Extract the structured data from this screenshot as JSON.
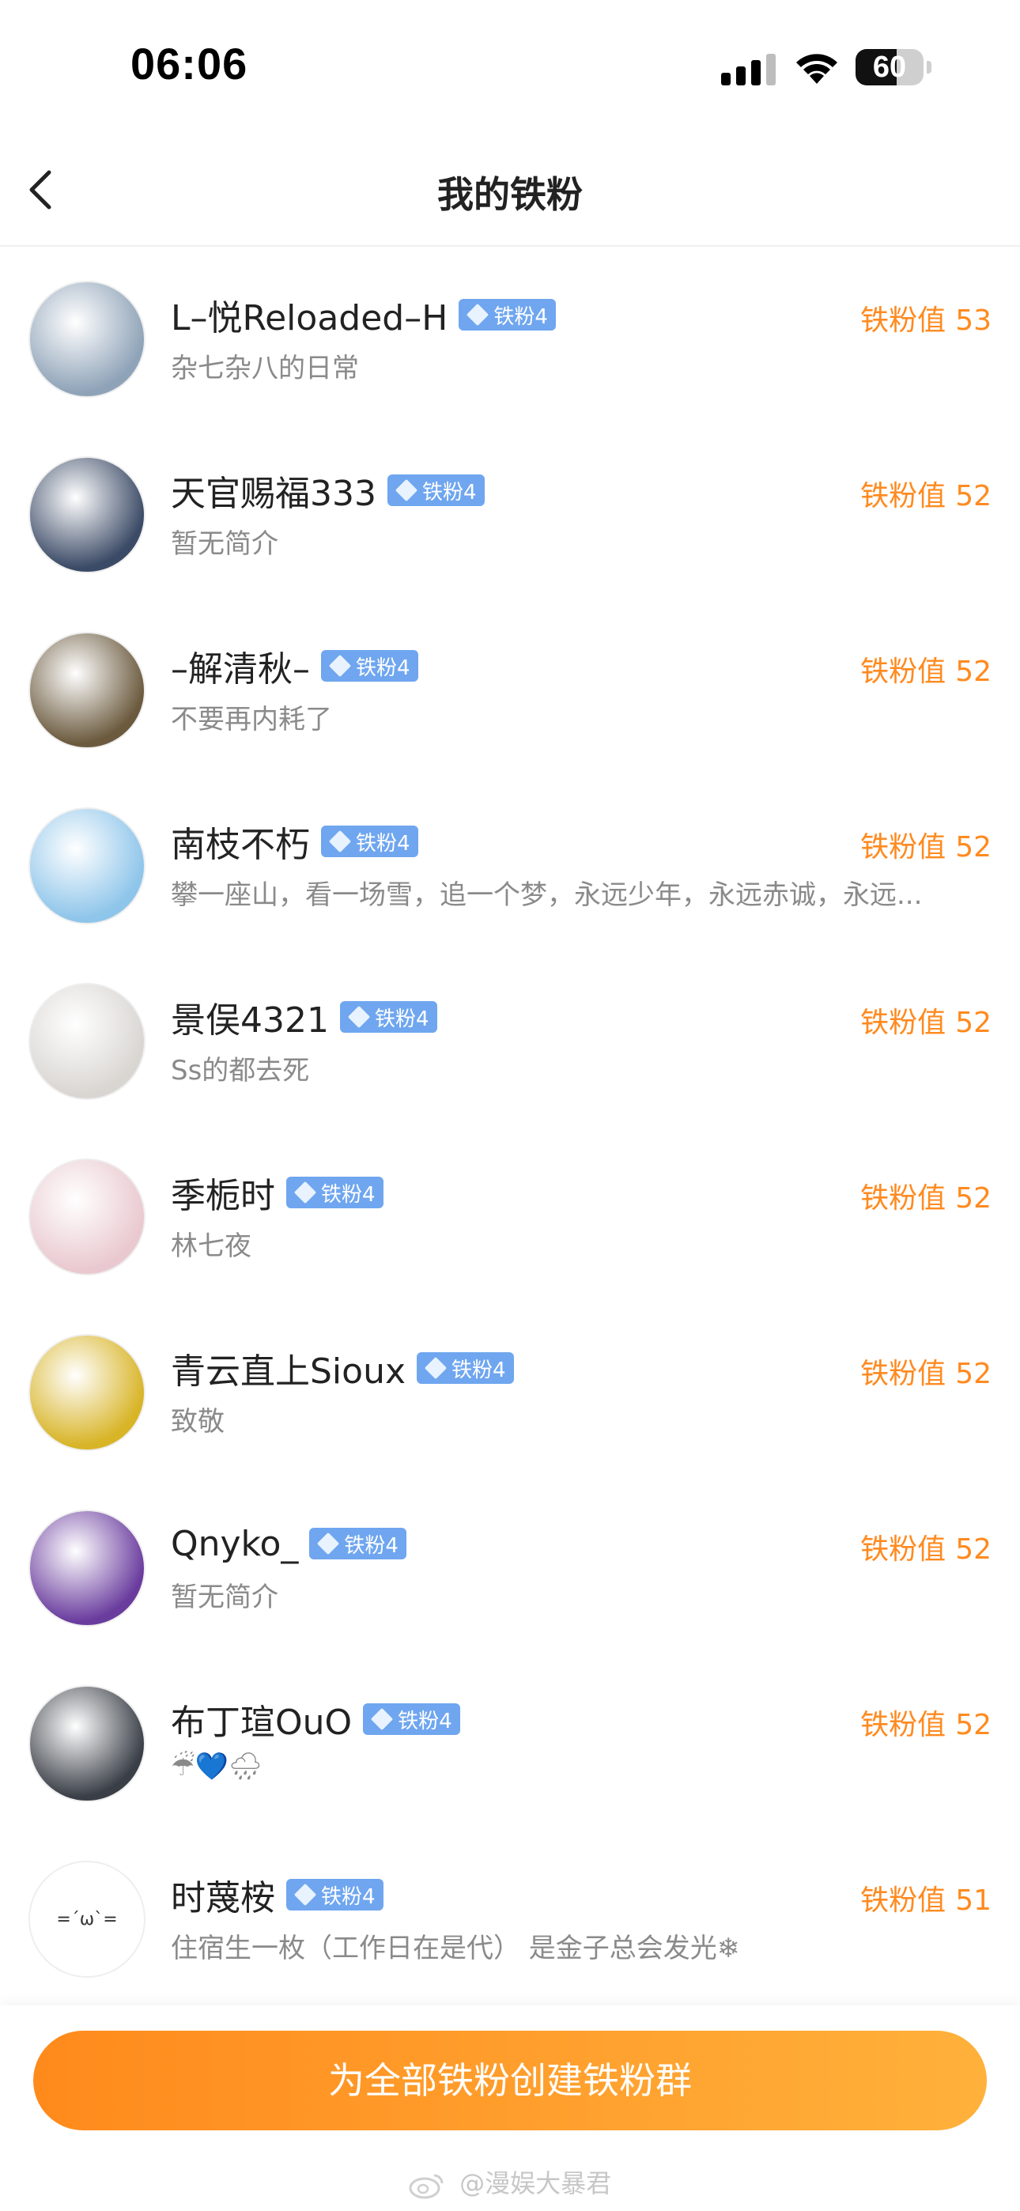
{
  "status_bar": {
    "time": "06:06",
    "battery_level": "60",
    "battery_fill_fraction": 0.6
  },
  "nav": {
    "title": "我的铁粉"
  },
  "score_label": "铁粉值",
  "fans": [
    {
      "name": "L–悦Reloaded–H",
      "badge": "铁粉4",
      "bio": "杂七杂八的日常",
      "score": "53",
      "avatar_color": "#8fa3b8"
    },
    {
      "name": "天官赐福333",
      "badge": "铁粉4",
      "bio": "暂无简介",
      "score": "52",
      "avatar_color": "#3b4a66"
    },
    {
      "name": "–解清秋–",
      "badge": "铁粉4",
      "bio": "不要再内耗了",
      "score": "52",
      "avatar_color": "#6b5a3e"
    },
    {
      "name": "南枝不朽",
      "badge": "铁粉4",
      "bio": "攀一座山，看一场雪，追一个梦，永远少年，永远赤诚，永远...",
      "score": "52",
      "avatar_color": "#8ec5ea"
    },
    {
      "name": "景俣4321",
      "badge": "铁粉4",
      "bio": "Ss的都去死",
      "score": "52",
      "avatar_color": "#d9d6d2"
    },
    {
      "name": "季栀时",
      "badge": "铁粉4",
      "bio": "林七夜",
      "score": "52",
      "avatar_color": "#e9c9cf"
    },
    {
      "name": "青云直上Sioux",
      "badge": "铁粉4",
      "bio": "致敬",
      "score": "52",
      "avatar_color": "#d8b427"
    },
    {
      "name": "Qnyko_",
      "badge": "铁粉4",
      "bio": "暂无简介",
      "score": "52",
      "avatar_color": "#6a3c9e"
    },
    {
      "name": "布丁瑄OuO",
      "badge": "铁粉4",
      "bio": "☔💙🌧",
      "score": "52",
      "avatar_color": "#3a3f47"
    },
    {
      "name": "时蔑桉",
      "badge": "铁粉4",
      "bio": "住宿生一枚（工作日在是代） 是金子总会发光❄",
      "score": "51",
      "avatar_color": "#ffffff",
      "avatar_text": "=´ω`="
    }
  ],
  "bottom": {
    "button_label": "为全部铁粉创建铁粉群",
    "watermark": "@漫娱大暴君"
  },
  "colors": {
    "accent": "#ff8a1f",
    "badge": "#6fa6ef"
  }
}
